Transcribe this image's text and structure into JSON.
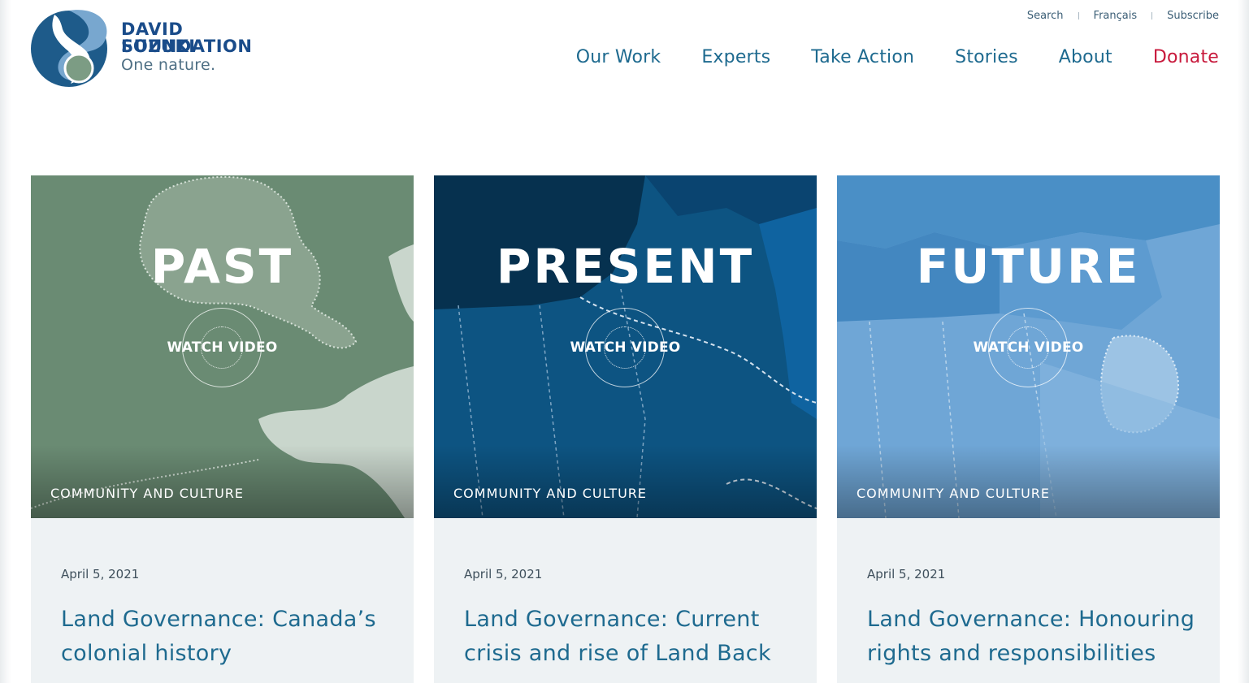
{
  "brand": {
    "name_line1": "DAVID SUZUKI",
    "name_line2": "FOUNDATION",
    "tagline": "One nature.",
    "logo_icon": "dsf-swirl-logo-icon",
    "colors": {
      "navy": "#1a4c8a",
      "teal": "#1e6a8f",
      "donate": "#c8193c"
    }
  },
  "utility_nav": [
    {
      "label": "Search"
    },
    {
      "label": "Français"
    },
    {
      "label": "Subscribe"
    }
  ],
  "main_nav": [
    {
      "label": "Our Work"
    },
    {
      "label": "Experts"
    },
    {
      "label": "Take Action"
    },
    {
      "label": "Stories"
    },
    {
      "label": "About"
    },
    {
      "label": "Donate"
    }
  ],
  "cards": [
    {
      "image_title": "PAST",
      "video_label": "WATCH VIDEO",
      "category": "COMMUNITY AND CULTURE",
      "date": "April 5, 2021",
      "headline": "Land Governance: Canada’s colonial history",
      "theme_color": "#6a8b73"
    },
    {
      "image_title": "PRESENT",
      "video_label": "WATCH VIDEO",
      "category": "COMMUNITY AND CULTURE",
      "date": "April 5, 2021",
      "headline": "Land Governance: Current crisis and rise of Land Back",
      "theme_color": "#0d5482"
    },
    {
      "image_title": "FUTURE",
      "video_label": "WATCH VIDEO",
      "category": "COMMUNITY AND CULTURE",
      "date": "April 5, 2021",
      "headline": "Land Governance: Honouring rights and responsibilities",
      "theme_color": "#4a8fc6"
    }
  ]
}
